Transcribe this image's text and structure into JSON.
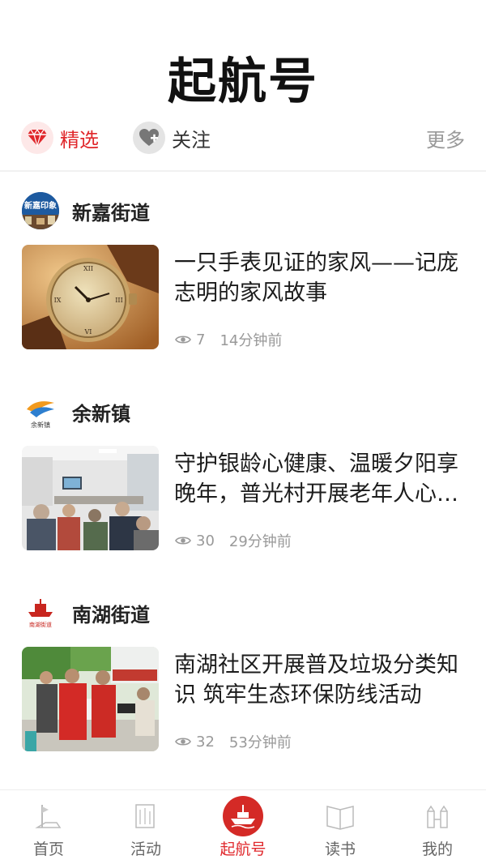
{
  "page_title": "起航号",
  "tabs": {
    "featured": {
      "label": "精选",
      "icon": "diamond-icon",
      "color": "#e0272b"
    },
    "follow": {
      "label": "关注",
      "icon": "heart-plus-icon"
    },
    "more": {
      "label": "更多"
    }
  },
  "feed": {
    "articles": [
      {
        "source": "新嘉街道",
        "source_logo_text": "新嘉印象",
        "title": "一只手表见证的家风——记庞志明的家风故事",
        "views": "7",
        "time": "14分钟前",
        "thumbnail": "wristwatch-photo"
      },
      {
        "source": "余新镇",
        "source_logo_text": "余新镇",
        "title": "守护银龄心健康、温暖夕阳享晚年，普光村开展老年人心理健康讲座",
        "views": "30",
        "time": "29分钟前",
        "thumbnail": "meeting-room-photo"
      },
      {
        "source": "南湖街道",
        "source_logo_text": "南湖街道",
        "title": "南湖社区开展普及垃圾分类知识 筑牢生态环保防线活动",
        "views": "32",
        "time": "53分钟前",
        "thumbnail": "volunteers-photo"
      }
    ]
  },
  "bottom_nav": {
    "items": [
      {
        "label": "首页",
        "icon": "home-icon"
      },
      {
        "label": "活动",
        "icon": "activity-icon"
      },
      {
        "label": "起航号",
        "icon": "red-boat-icon",
        "active": true
      },
      {
        "label": "读书",
        "icon": "book-icon"
      },
      {
        "label": "我的",
        "icon": "profile-icon"
      }
    ]
  },
  "colors": {
    "accent": "#e0272b",
    "muted": "#999999",
    "text": "#1c1c1c"
  }
}
